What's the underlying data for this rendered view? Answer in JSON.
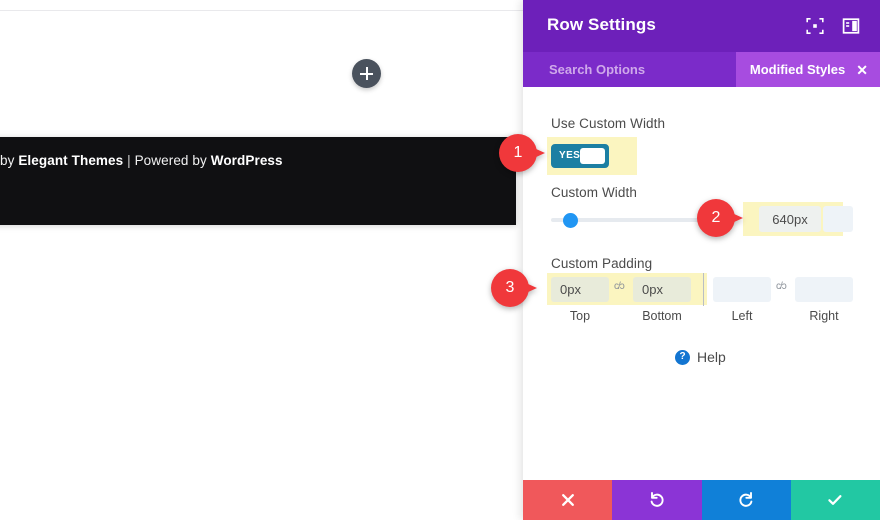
{
  "canvas": {
    "add_row_icon": "plus-icon",
    "footer": {
      "credit_prefix": "by ",
      "credit_brand": "Elegant Themes",
      "credit_separator": " | ",
      "credit_middle": "Powered by ",
      "credit_platform": "WordPress"
    }
  },
  "panel": {
    "title": "Row Settings",
    "header_icons": [
      {
        "name": "expand-icon"
      },
      {
        "name": "layout-panel-icon"
      }
    ],
    "search": {
      "placeholder": "Search Options",
      "value": ""
    },
    "modified_styles": {
      "label": "Modified Styles",
      "close_icon": "close-icon"
    },
    "fields": {
      "use_custom_width": {
        "label": "Use Custom Width",
        "toggle_value": "YES",
        "enabled": true
      },
      "custom_width": {
        "label": "Custom Width",
        "value": "640px",
        "slider_position_percent": 13,
        "unit_selector": "unit-dropdown"
      },
      "custom_padding": {
        "label": "Custom Padding",
        "top": {
          "caption": "Top",
          "value": "0px"
        },
        "bottom": {
          "caption": "Bottom",
          "value": "0px"
        },
        "left": {
          "caption": "Left",
          "value": ""
        },
        "right": {
          "caption": "Right",
          "value": ""
        },
        "link_glyph": "c/ɔ"
      }
    },
    "help": {
      "icon": "question-mark-icon",
      "label": "Help"
    },
    "actions": [
      {
        "name": "cancel-button",
        "icon": "close-icon",
        "color": "#f0585b"
      },
      {
        "name": "undo-button",
        "icon": "undo-icon",
        "color": "#8b34d6"
      },
      {
        "name": "redo-button",
        "icon": "redo-icon",
        "color": "#1080d8"
      },
      {
        "name": "save-button",
        "icon": "check-icon",
        "color": "#22c8a3"
      }
    ]
  },
  "callouts": [
    {
      "number": "1"
    },
    {
      "number": "2"
    },
    {
      "number": "3"
    }
  ],
  "colors": {
    "panel_header": "#6d20ba",
    "panel_subbar": "#7b2bc9",
    "pill": "#a74ce0",
    "toggle_on": "#1c7fa3",
    "slider_handle": "#2196f3",
    "highlight": "#fbf5c0",
    "callout": "#f0383b"
  }
}
